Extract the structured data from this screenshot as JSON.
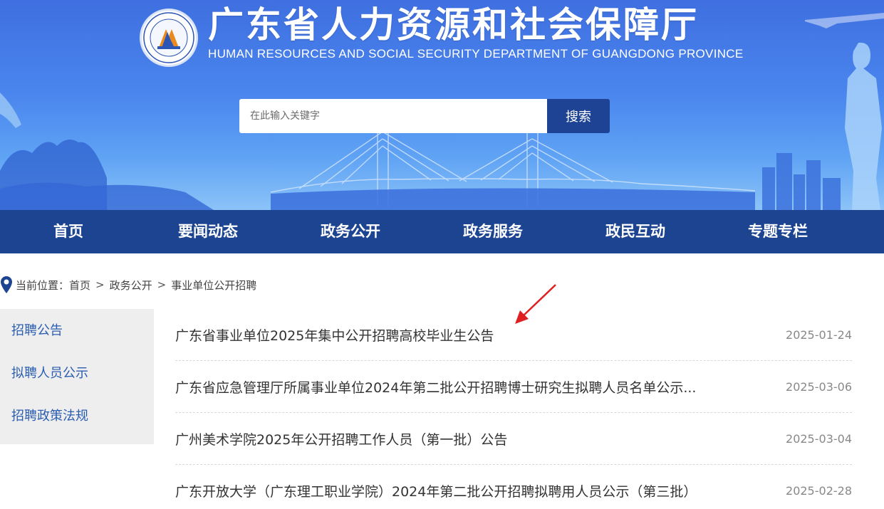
{
  "header": {
    "title": "广东省人力资源和社会保障厅",
    "subtitle": "HUMAN RESOURCES AND SOCIAL SECURITY DEPARTMENT OF GUANGDONG PROVINCE",
    "search_placeholder": "在此输入关键字",
    "search_button": "搜索"
  },
  "nav": {
    "items": [
      {
        "label": "首页"
      },
      {
        "label": "要闻动态"
      },
      {
        "label": "政务公开"
      },
      {
        "label": "政务服务"
      },
      {
        "label": "政民互动"
      },
      {
        "label": "专题专栏"
      }
    ]
  },
  "breadcrumb": {
    "prefix": "当前位置：",
    "items": [
      "首页",
      "政务公开",
      "事业单位公开招聘"
    ],
    "separator": ">"
  },
  "sidebar": {
    "items": [
      {
        "label": "招聘公告"
      },
      {
        "label": "拟聘人员公示"
      },
      {
        "label": "招聘政策法规"
      }
    ]
  },
  "news": {
    "items": [
      {
        "title": "广东省事业单位2025年集中公开招聘高校毕业生公告",
        "date": "2025-01-24"
      },
      {
        "title": "广东省应急管理厅所属事业单位2024年第二批公开招聘博士研究生拟聘人员名单公示...",
        "date": "2025-03-06"
      },
      {
        "title": "广州美术学院2025年公开招聘工作人员（第一批）公告",
        "date": "2025-03-04"
      },
      {
        "title": "广东开放大学（广东理工职业学院）2024年第二批公开招聘拟聘用人员公示（第三批）",
        "date": "2025-02-28"
      }
    ]
  },
  "colors": {
    "nav_bg": "#1d4491",
    "search_button_bg": "#1e4395",
    "sidebar_bg": "#eeeeee",
    "sidebar_link": "#2a5db0",
    "annotation_arrow": "#e02020"
  }
}
